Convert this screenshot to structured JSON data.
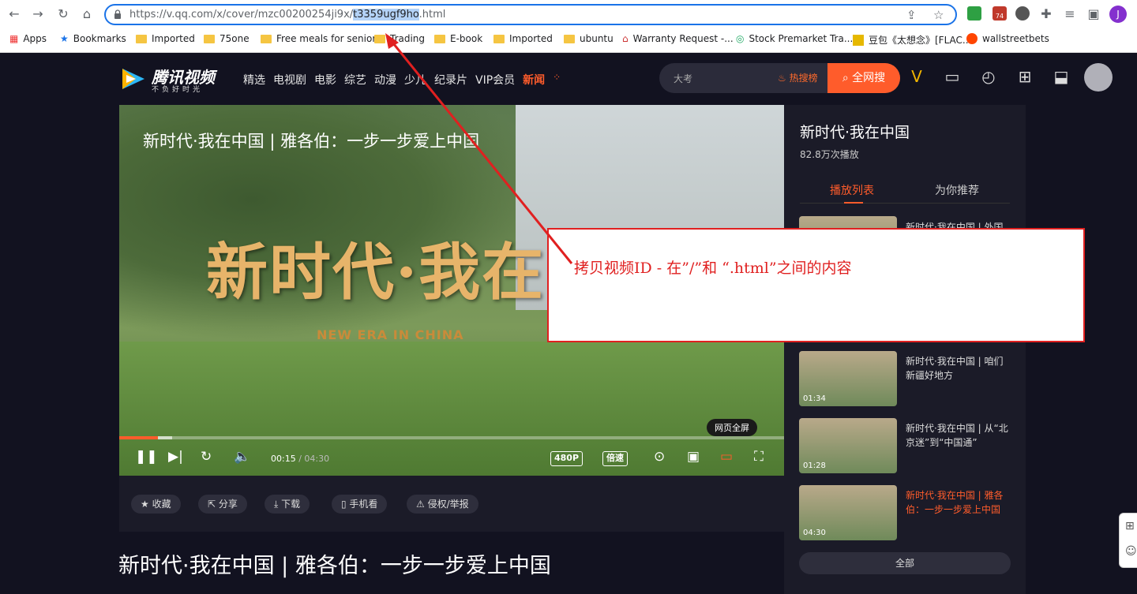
{
  "browser": {
    "url_prefix": "https://v.qq.com/x/cover/mzc00200254ji9x/",
    "url_highlight": "t3359ugf9ho",
    "url_suffix": ".html",
    "profile_initial": "J",
    "ext_badge": "74",
    "bookmarks": [
      {
        "label": "Apps"
      },
      {
        "label": "Bookmarks"
      },
      {
        "label": "Imported"
      },
      {
        "label": "75one"
      },
      {
        "label": "Free meals for senior"
      },
      {
        "label": "Trading"
      },
      {
        "label": "E-book"
      },
      {
        "label": "Imported"
      },
      {
        "label": "ubuntu"
      },
      {
        "label": "Warranty Request -..."
      },
      {
        "label": "Stock Premarket Tra..."
      },
      {
        "label": "豆包《太想念》[FLAC..."
      },
      {
        "label": "wallstreetbets"
      }
    ]
  },
  "site": {
    "logo_text": "腾讯视频",
    "logo_sub": "不负好时光",
    "nav": [
      "精选",
      "电视剧",
      "电影",
      "综艺",
      "动漫",
      "少儿",
      "纪录片",
      "VIP会员",
      "新闻"
    ],
    "search_placeholder": "大考",
    "hot_label": "热搜榜",
    "search_button": "全网搜"
  },
  "player": {
    "title": "新时代·我在中国 | 雅各伯：一步一步爱上中国",
    "calligraphy": "新时代·我在",
    "calligraphy_en": "NEW ERA IN CHINA",
    "current_time": "00:15",
    "total_time": "04:30",
    "progress": 0.058,
    "buffered": 0.08,
    "quality": "480P",
    "speed": "倍速",
    "fullscreen_web": "网页全屏"
  },
  "actions": [
    "收藏",
    "分享",
    "下载",
    "手机看",
    "侵权/举报"
  ],
  "page_title": "新时代·我在中国 | 雅各伯：一步一步爱上中国",
  "sidebar": {
    "title": "新时代·我在中国",
    "plays": "82.8万次播放",
    "tabs": [
      "播放列表",
      "为你推荐"
    ],
    "episodes": [
      {
        "title": "新时代·我在中国 | 外国",
        "duration": ""
      },
      {
        "title": "新时代·我在中国 | 咱们新疆好地方",
        "duration": "01:34"
      },
      {
        "title": "新时代·我在中国 | 从“北京迷”到“中国通”",
        "duration": "01:28"
      },
      {
        "title": "新时代·我在中国 | 雅各伯：一步一步爱上中国",
        "duration": "04:30"
      }
    ],
    "all_button": "全部"
  },
  "annotation": {
    "text": "拷贝视频ID - 在”/”和 “.html”之间的内容"
  },
  "colors": {
    "accent": "#ff5c2b",
    "annotation": "#e02020",
    "url_highlight": "#b4d3f8"
  }
}
